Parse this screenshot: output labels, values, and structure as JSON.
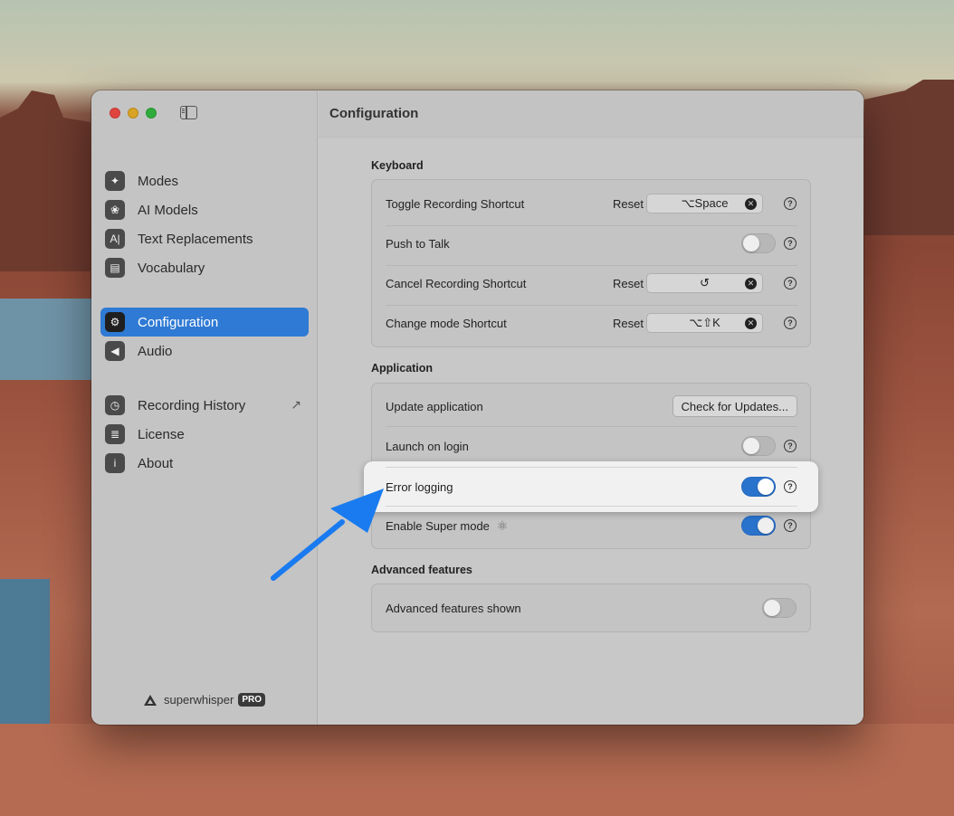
{
  "sidebar": {
    "items": [
      {
        "label": "Modes",
        "icon": "sparkle-icon"
      },
      {
        "label": "AI Models",
        "icon": "brain-icon"
      },
      {
        "label": "Text Replacements",
        "icon": "text-cursor-icon"
      },
      {
        "label": "Vocabulary",
        "icon": "book-icon"
      },
      {
        "label": "Configuration",
        "icon": "gear-icon",
        "active": true
      },
      {
        "label": "Audio",
        "icon": "speaker-icon"
      },
      {
        "label": "Recording History",
        "icon": "clock-icon"
      },
      {
        "label": "License",
        "icon": "document-icon"
      },
      {
        "label": "About",
        "icon": "info-icon"
      }
    ],
    "brand": "superwhisper",
    "badge": "PRO"
  },
  "main": {
    "title": "Configuration",
    "keyboard": {
      "title": "Keyboard",
      "toggle_recording": {
        "label": "Toggle Recording Shortcut",
        "reset": "Reset",
        "shortcut": "⌥Space"
      },
      "push_to_talk": {
        "label": "Push to Talk",
        "enabled": false
      },
      "cancel_recording": {
        "label": "Cancel Recording Shortcut",
        "reset": "Reset",
        "shortcut": "↺"
      },
      "change_mode": {
        "label": "Change mode Shortcut",
        "reset": "Reset",
        "shortcut": "⌥⇧K"
      }
    },
    "application": {
      "title": "Application",
      "update": {
        "label": "Update application",
        "button": "Check for Updates..."
      },
      "launch_on_login": {
        "label": "Launch on login",
        "enabled": false
      },
      "error_logging": {
        "label": "Error logging",
        "enabled": true
      },
      "super_mode": {
        "label": "Enable Super mode",
        "enabled": true
      }
    },
    "advanced": {
      "title": "Advanced features",
      "shown": {
        "label": "Advanced features shown",
        "enabled": false
      }
    }
  },
  "help_symbol": "?",
  "clear_symbol": "✕",
  "colors": {
    "accent": "#2f7ad4",
    "arrow": "#1a7bf0"
  }
}
